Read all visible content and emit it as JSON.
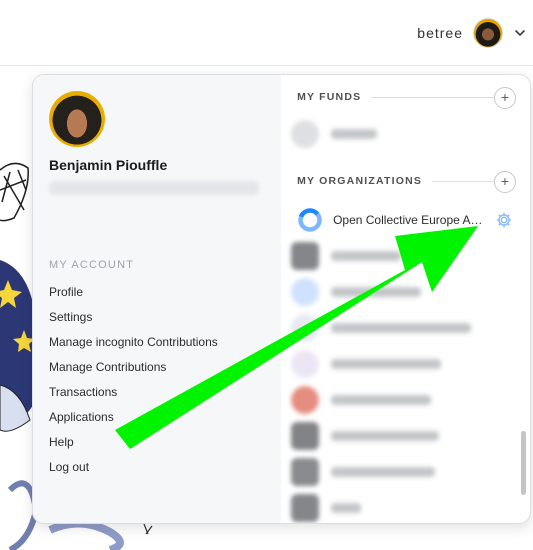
{
  "header": {
    "username": "betree",
    "avatar_icon": "avatar-icon",
    "chevron_icon": "chevron-down-icon"
  },
  "profile": {
    "name": "Benjamin Piouffle"
  },
  "my_account": {
    "title": "MY ACCOUNT",
    "links": [
      "Profile",
      "Settings",
      "Manage incognito Contributions",
      "Manage Contributions",
      "Transactions",
      "Applications",
      "Help",
      "Log out"
    ]
  },
  "my_funds": {
    "title": "MY FUNDS",
    "add_symbol": "+"
  },
  "my_organizations": {
    "title": "MY ORGANIZATIONS",
    "add_symbol": "+",
    "first_org": "Open Collective Europe ASBL"
  },
  "colors": {
    "arrow": "#00f400",
    "accent": "#1f87ff",
    "left_pane_bg": "#f6f7f8"
  }
}
